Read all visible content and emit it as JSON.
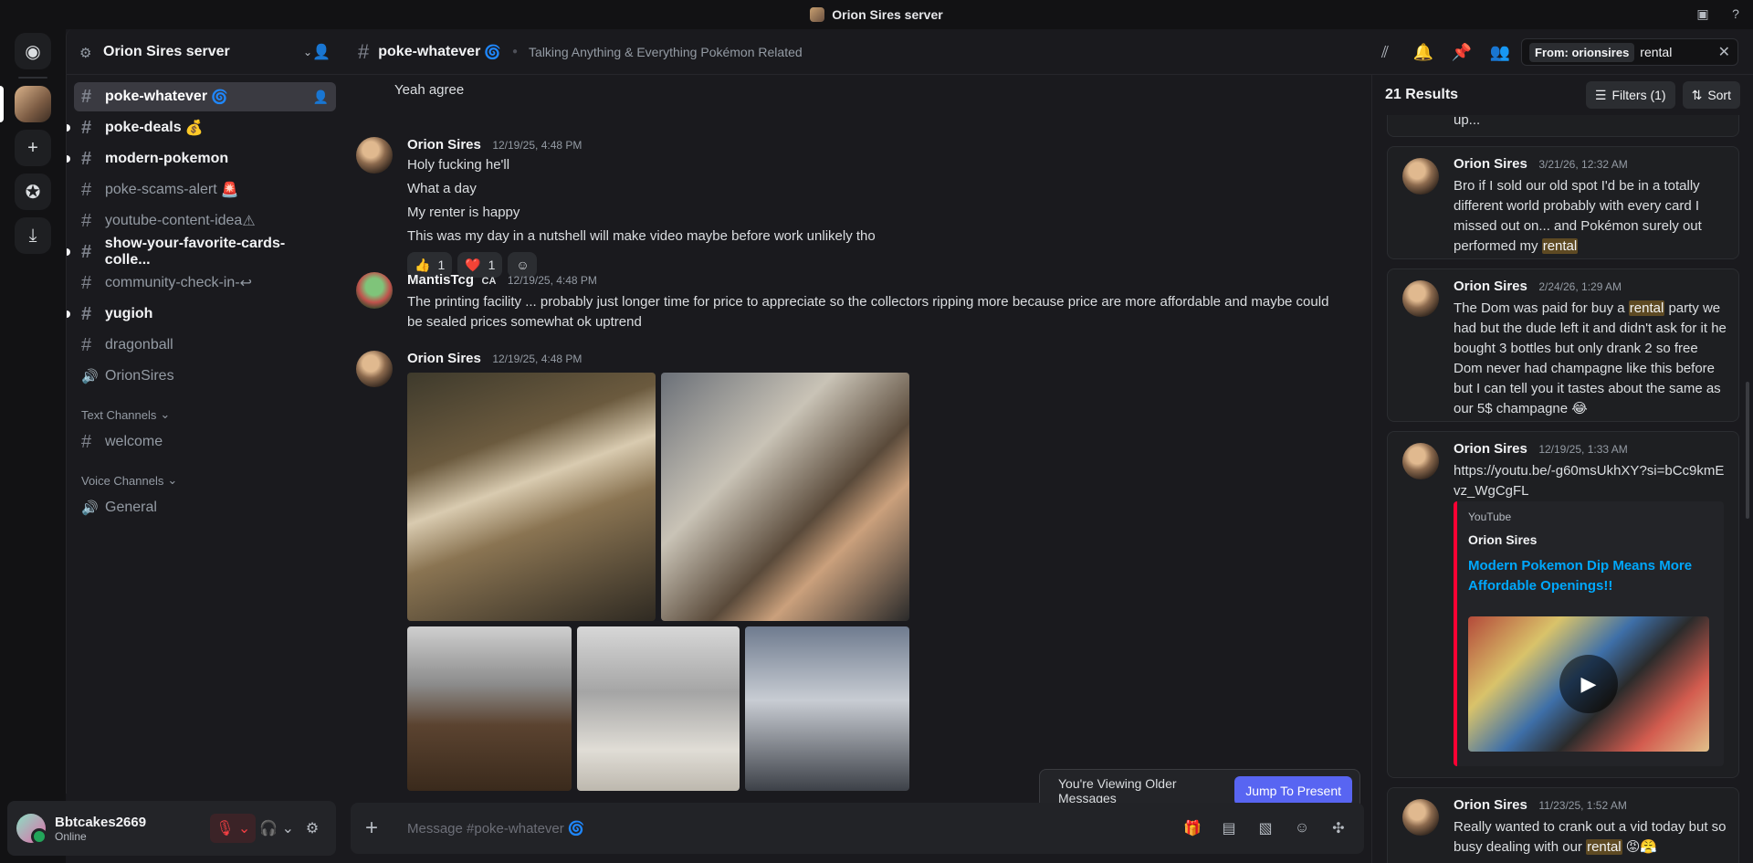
{
  "window": {
    "title": "Orion Sires server"
  },
  "server": {
    "name": "Orion Sires server"
  },
  "channels": [
    {
      "name": "poke-whatever",
      "suffix": "🌀",
      "state": "active",
      "icon": "#"
    },
    {
      "name": "poke-deals",
      "suffix": "💰",
      "state": "unread",
      "icon": "#"
    },
    {
      "name": "modern-pokemon",
      "suffix": "",
      "state": "unread",
      "icon": "#"
    },
    {
      "name": "poke-scams-alert",
      "suffix": "🚨",
      "state": "normal",
      "icon": "#"
    },
    {
      "name": "youtube-content-idea",
      "suffix": "⚠",
      "state": "normal",
      "icon": "#"
    },
    {
      "name": "show-your-favorite-cards-colle...",
      "suffix": "",
      "state": "unread",
      "icon": "#"
    },
    {
      "name": "community-check-in-",
      "suffix": "↩",
      "state": "normal",
      "icon": "#"
    },
    {
      "name": "yugioh",
      "suffix": "",
      "state": "unread",
      "icon": "#"
    },
    {
      "name": "dragonball",
      "suffix": "",
      "state": "normal",
      "icon": "#"
    },
    {
      "name": "OrionSires",
      "suffix": "",
      "state": "normal",
      "icon": "speaker"
    }
  ],
  "categories": {
    "text": {
      "label": "Text Channels",
      "channels": [
        "welcome"
      ]
    },
    "voice": {
      "label": "Voice Channels",
      "channels": [
        "General"
      ]
    }
  },
  "user": {
    "name": "Bbtcakes2669",
    "status": "Online"
  },
  "header": {
    "channel": "poke-whatever",
    "swirl": "🌀",
    "topic": "Talking Anything & Everything Pokémon Related"
  },
  "search": {
    "tag": "From: orionsires",
    "query": "rental"
  },
  "messages": {
    "top_line": "Yeah agree",
    "m1": {
      "author": "Orion Sires",
      "time": "12/19/25, 4:48 PM",
      "lines": [
        "Holy fucking he'll",
        "What a day",
        "My renter is happy",
        "This was my day in a nutshell will make video maybe before work unlikely tho"
      ],
      "reactions": [
        {
          "emoji": "👍",
          "count": "1"
        },
        {
          "emoji": "❤️",
          "count": "1"
        }
      ]
    },
    "m2": {
      "author": "MantisTcg",
      "tag": "CA",
      "time": "12/19/25, 4:48 PM",
      "text": "The printing facility ... probably just longer time for price to appreciate so the collectors ripping more because price are more affordable and maybe could be sealed prices somewhat ok uptrend"
    },
    "m3": {
      "author": "Orion Sires",
      "time": "12/19/25, 4:48 PM"
    }
  },
  "banner": {
    "text": "You're Viewing Older Messages",
    "button": "Jump To Present"
  },
  "composer": {
    "placeholder": "Message #poke-whatever 🌀"
  },
  "results": {
    "count": "21 Results",
    "filters": "Filters (1)",
    "sort": "Sort",
    "partial": "up...",
    "r1": {
      "author": "Orion Sires",
      "time": "3/21/26, 12:32 AM",
      "pre": "Bro if I sold our old spot I'd be in a totally different world probably with every card I missed out on... and Pokémon surely out performed my ",
      "hit": "rental",
      "post": ""
    },
    "r2": {
      "author": "Orion Sires",
      "time": "2/24/26, 1:29 AM",
      "pre": "The Dom was paid for buy a ",
      "hit": "rental",
      "post": " party we had but the dude left it and didn't ask for it he bought 3 bottles but only drank 2 so free Dom never had champagne like this before but I can tell you it tastes about the same as our 5$ champagne 😂"
    },
    "r3": {
      "author": "Orion Sires",
      "time": "12/19/25, 1:33 AM",
      "link": "https://youtu.be/-g60msUkhXY?si=bCc9kmEvz_WgCgFL",
      "embed": {
        "provider": "YouTube",
        "author": "Orion Sires",
        "title": "Modern Pokemon Dip Means More Affordable Openings!!"
      }
    },
    "r4": {
      "author": "Orion Sires",
      "time": "11/23/25, 1:52 AM",
      "pre": "Really wanted to crank out a vid today but so busy dealing with our ",
      "hit": "rental",
      "post": " 😡😤"
    }
  }
}
